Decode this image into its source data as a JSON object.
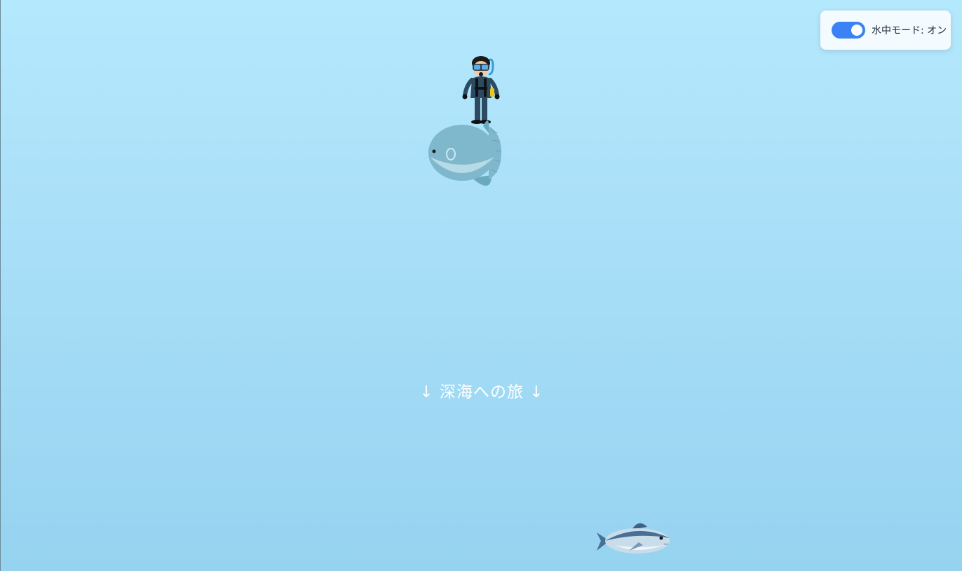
{
  "mode_toggle": {
    "label": "水中モード: オン",
    "state": "on",
    "accent_color": "#3b82f6"
  },
  "depth_banner": {
    "text": "↓ 深海への旅 ↓"
  },
  "sprites": {
    "diver": "scuba-diver",
    "sunfish": "ocean-sunfish",
    "tuna": "tuna-fish"
  },
  "colors": {
    "water_top": "#b4e8fd",
    "water_bottom": "#96d3f0"
  }
}
